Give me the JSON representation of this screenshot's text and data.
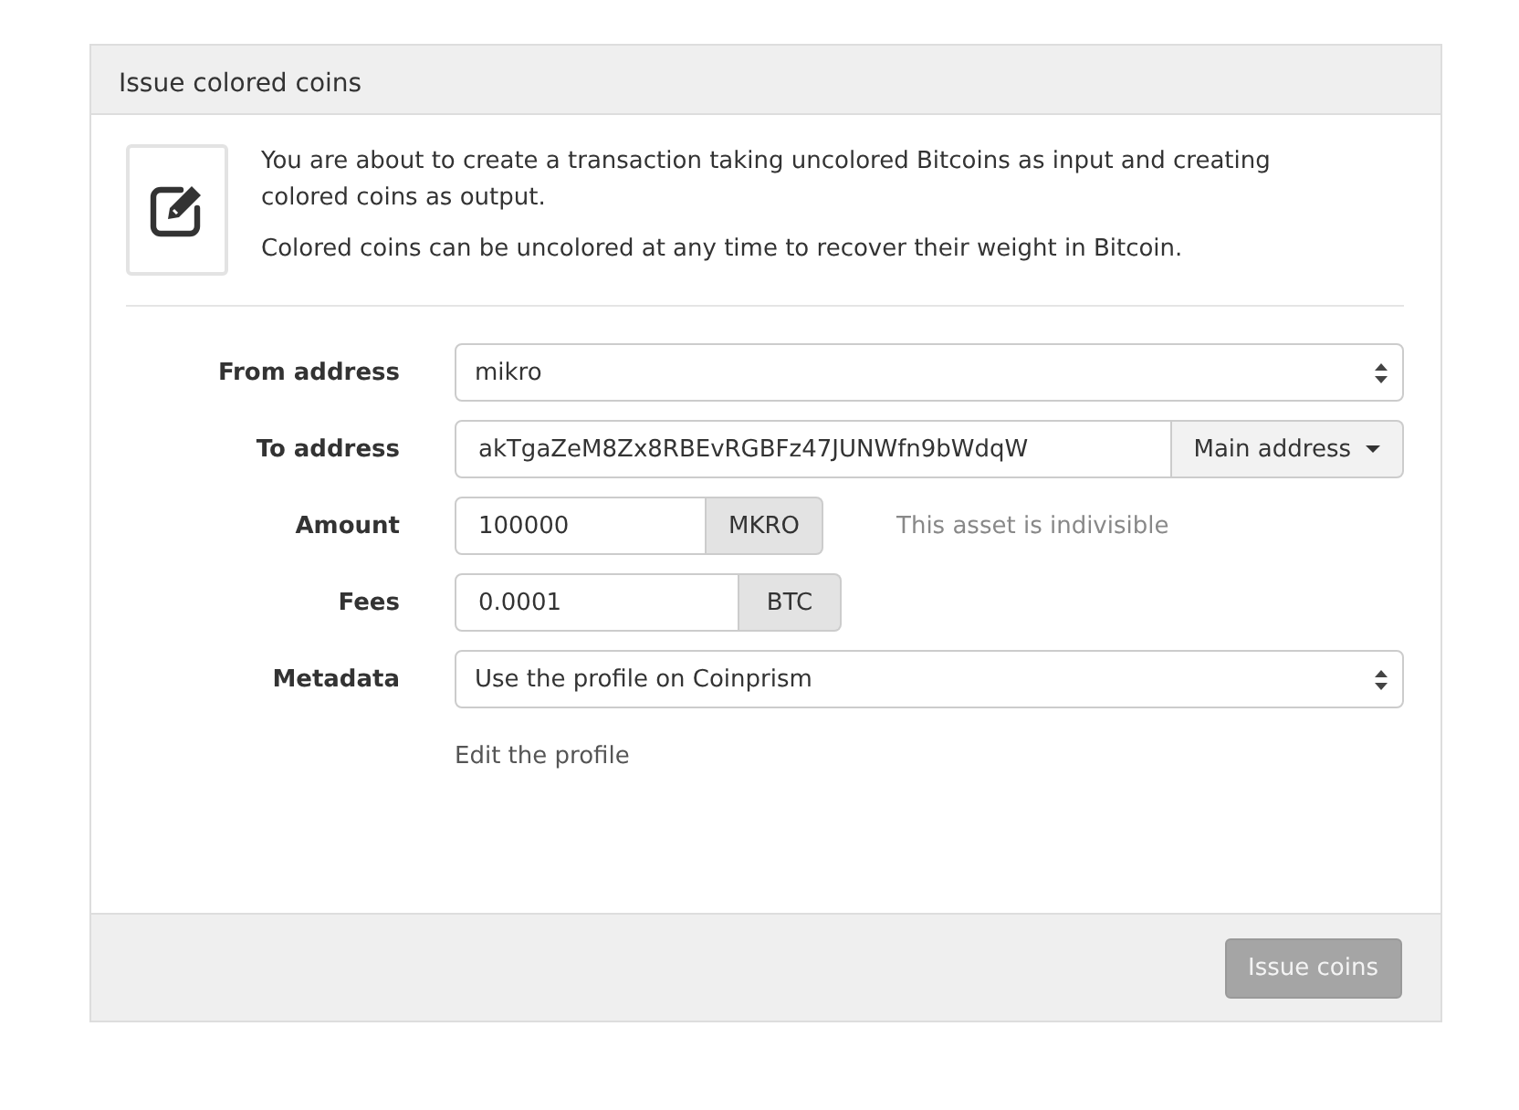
{
  "panel": {
    "title": "Issue colored coins"
  },
  "intro": {
    "paragraphs": [
      "You are about to create a transaction taking uncolored Bitcoins as input and creating colored coins as output.",
      "Colored coins can be uncolored at any time to recover their weight in Bitcoin."
    ]
  },
  "form": {
    "rows": [
      {
        "kind": "select",
        "label": "From address",
        "value": "mikro"
      },
      {
        "kind": "dropdown_input",
        "label": "To address",
        "value": "akTgaZeM8Zx8RBEvRGBFz47JUNWfn9bWdqW",
        "button": "Main address"
      },
      {
        "kind": "addon_input",
        "label": "Amount",
        "value": "100000",
        "addon": "MKRO",
        "note": "This asset is indivisible"
      },
      {
        "kind": "addon_input",
        "label": "Fees",
        "value": "0.0001",
        "addon": "BTC"
      },
      {
        "kind": "select",
        "label": "Metadata",
        "value": "Use the profile on Coinprism"
      },
      {
        "kind": "link",
        "text": "Edit the profile"
      }
    ]
  },
  "footer": {
    "button": {
      "label": "Issue coins",
      "disabled": true
    }
  }
}
